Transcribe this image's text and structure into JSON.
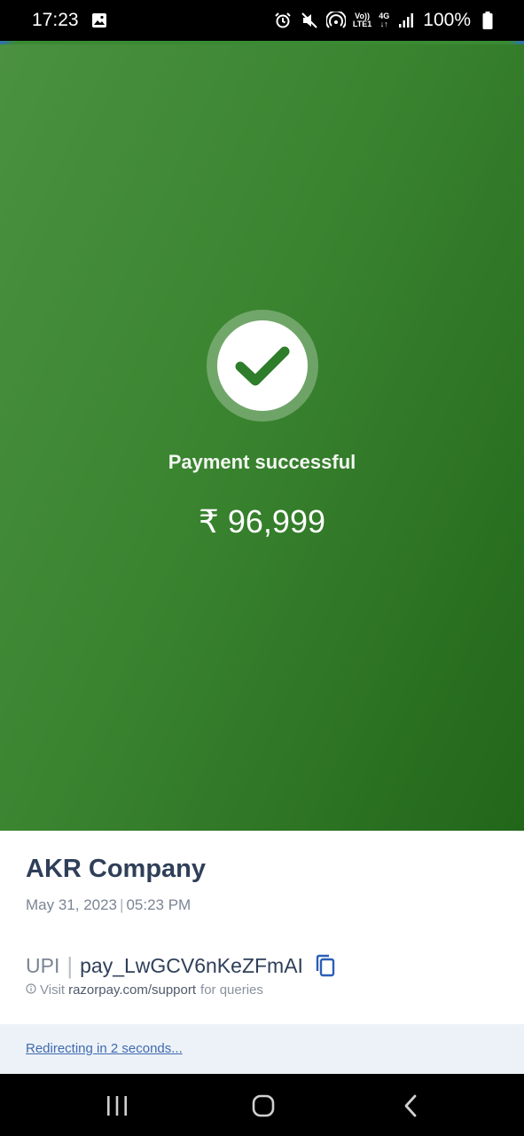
{
  "status_bar": {
    "time": "17:23",
    "volte_line1": "Vo))",
    "volte_line2": "LTE1",
    "network": "4G",
    "battery": "100%",
    "icons": [
      "gallery-icon",
      "alarm-icon",
      "mute-icon",
      "hotspot-icon",
      "signal-icon",
      "battery-icon"
    ]
  },
  "payment": {
    "status_title": "Payment successful",
    "amount": "₹ 96,999"
  },
  "details": {
    "merchant": "AKR Company",
    "date": "May 31, 2023",
    "time": "05:23 PM",
    "method": "UPI",
    "payment_id": "pay_LwGCV6nKeZFmAI",
    "support_visit": "Visit",
    "support_link": "razorpay.com/support",
    "support_suffix": "for queries"
  },
  "footer": {
    "redirect_text": "Redirecting in 2 seconds..."
  },
  "colors": {
    "success_green": "#3a8430",
    "merchant_text": "#2f3f59",
    "link_blue": "#3f6ab0",
    "copy_icon_blue": "#2a5fb8"
  }
}
